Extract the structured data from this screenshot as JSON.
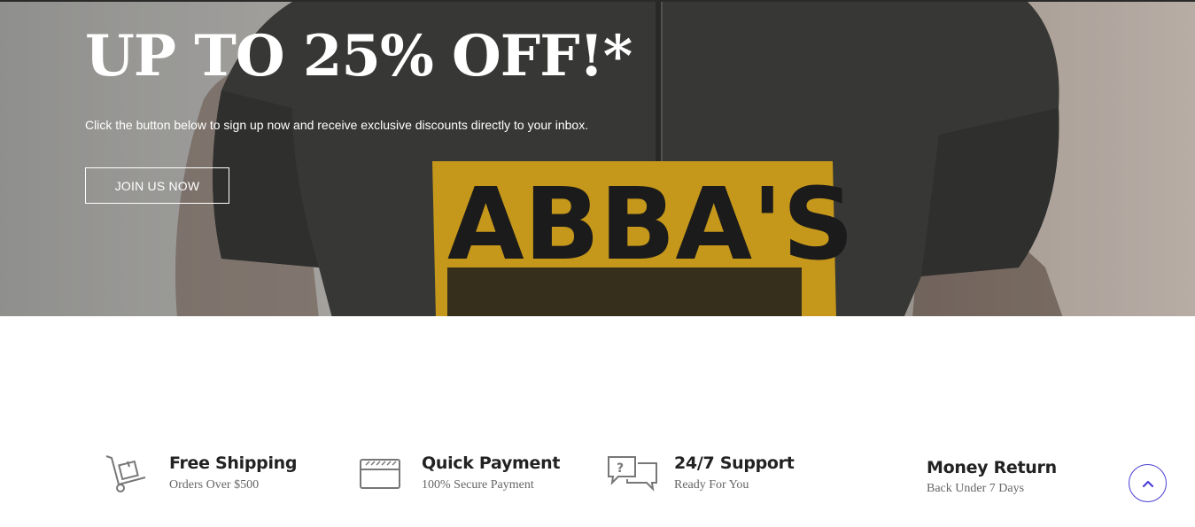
{
  "hero": {
    "title": "UP TO 25% OFF!*",
    "subtitle": "Click the button below to sign up now and receive exclusive discounts directly to your inbox.",
    "button_label": "JOIN US NOW",
    "shirt_print": "ABBA'S"
  },
  "features": [
    {
      "icon": "hand-truck-icon",
      "title": "Free Shipping",
      "subtitle": "Orders Over $500"
    },
    {
      "icon": "credit-card-icon",
      "title": "Quick Payment",
      "subtitle": "100% Secure Payment"
    },
    {
      "icon": "chat-bubbles-icon",
      "title": "24/7 Support",
      "subtitle": "Ready For You"
    },
    {
      "icon": "",
      "title": "Money Return",
      "subtitle": "Back Under 7 Days"
    }
  ],
  "scroll_top": {
    "icon": "chevron-up-icon"
  },
  "colors": {
    "accent": "#4b3fd6",
    "shirt": "#3c3c3a",
    "print": "#d6a51e"
  }
}
